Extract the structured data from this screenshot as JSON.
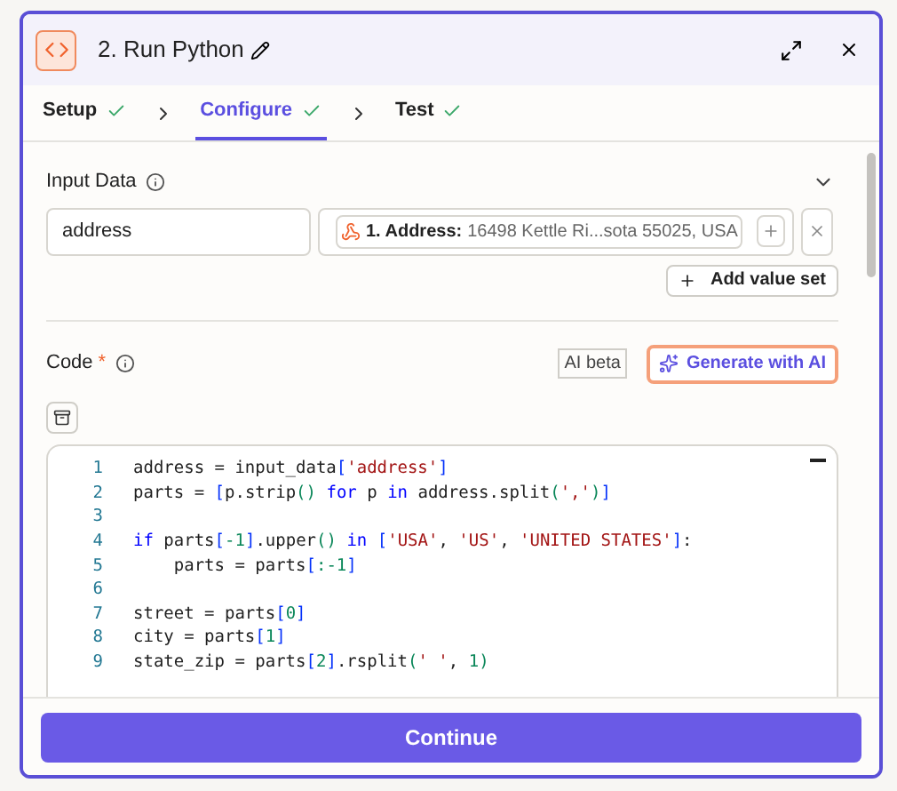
{
  "header": {
    "title": "2. Run Python"
  },
  "steps": [
    {
      "label": "Setup",
      "selected": false,
      "done": true
    },
    {
      "label": "Configure",
      "selected": true,
      "done": true
    },
    {
      "label": "Test",
      "selected": false,
      "done": true
    }
  ],
  "input_data": {
    "label": "Input Data",
    "expanded": true,
    "rows": [
      {
        "key": "address",
        "value_label": "1. Address:",
        "value": "16498 Kettle Ri...sota 55025, USA"
      }
    ],
    "add_button": "Add value set"
  },
  "code": {
    "label": "Code",
    "required_mark": "*",
    "ai_badge": "AI beta",
    "generate_button": "Generate with AI",
    "lines": [
      {
        "number": "1",
        "tokens": [
          {
            "text": "address = input_data",
            "kind": "plain"
          },
          {
            "text": "[",
            "kind": "bracket"
          },
          {
            "text": "'address'",
            "kind": "string"
          },
          {
            "text": "]",
            "kind": "bracket"
          }
        ]
      },
      {
        "number": "2",
        "tokens": [
          {
            "text": "parts = ",
            "kind": "plain"
          },
          {
            "text": "[",
            "kind": "bracket"
          },
          {
            "text": "p.strip",
            "kind": "plain"
          },
          {
            "text": "() ",
            "kind": "number"
          },
          {
            "text": "for",
            "kind": "keyword"
          },
          {
            "text": " p ",
            "kind": "plain"
          },
          {
            "text": "in",
            "kind": "keyword"
          },
          {
            "text": " address.split",
            "kind": "plain"
          },
          {
            "text": "(",
            "kind": "number"
          },
          {
            "text": "','",
            "kind": "string"
          },
          {
            "text": ")",
            "kind": "number"
          },
          {
            "text": "]",
            "kind": "bracket"
          }
        ]
      },
      {
        "number": "3"
      },
      {
        "number": "4",
        "tokens": [
          {
            "text": "if",
            "kind": "keyword"
          },
          {
            "text": " parts",
            "kind": "plain"
          },
          {
            "text": "[",
            "kind": "bracket"
          },
          {
            "text": "-1",
            "kind": "number"
          },
          {
            "text": "]",
            "kind": "bracket"
          },
          {
            "text": ".upper",
            "kind": "plain"
          },
          {
            "text": "() ",
            "kind": "number"
          },
          {
            "text": "in",
            "kind": "keyword"
          },
          {
            "text": " [",
            "kind": "bracket"
          },
          {
            "text": "'USA'",
            "kind": "string"
          },
          {
            "text": ", ",
            "kind": "plain"
          },
          {
            "text": "'US'",
            "kind": "string"
          },
          {
            "text": ", ",
            "kind": "plain"
          },
          {
            "text": "'UNITED STATES'",
            "kind": "string"
          },
          {
            "text": "]",
            "kind": "bracket"
          },
          {
            "text": ":",
            "kind": "plain"
          }
        ]
      },
      {
        "number": "5",
        "tokens": [
          {
            "text": "    parts = parts",
            "kind": "plain"
          },
          {
            "text": "[",
            "kind": "bracket"
          },
          {
            "text": ":-1",
            "kind": "number"
          },
          {
            "text": "]",
            "kind": "bracket"
          }
        ]
      },
      {
        "number": "6"
      },
      {
        "number": "7",
        "tokens": [
          {
            "text": "street = parts",
            "kind": "plain"
          },
          {
            "text": "[",
            "kind": "bracket"
          },
          {
            "text": "0",
            "kind": "number"
          },
          {
            "text": "]",
            "kind": "bracket"
          }
        ]
      },
      {
        "number": "8",
        "tokens": [
          {
            "text": "city = parts",
            "kind": "plain"
          },
          {
            "text": "[",
            "kind": "bracket"
          },
          {
            "text": "1",
            "kind": "number"
          },
          {
            "text": "]",
            "kind": "bracket"
          }
        ]
      },
      {
        "number": "9",
        "tokens": [
          {
            "text": "state_zip = parts",
            "kind": "plain"
          },
          {
            "text": "[",
            "kind": "bracket"
          },
          {
            "text": "2",
            "kind": "number"
          },
          {
            "text": "]",
            "kind": "bracket"
          },
          {
            "text": ".rsplit",
            "kind": "plain"
          },
          {
            "text": "(",
            "kind": "number"
          },
          {
            "text": "' '",
            "kind": "string"
          },
          {
            "text": ", ",
            "kind": "plain"
          },
          {
            "text": "1",
            "kind": "number"
          },
          {
            "text": ")",
            "kind": "number"
          }
        ]
      }
    ]
  },
  "footer": {
    "button": "Continue"
  }
}
